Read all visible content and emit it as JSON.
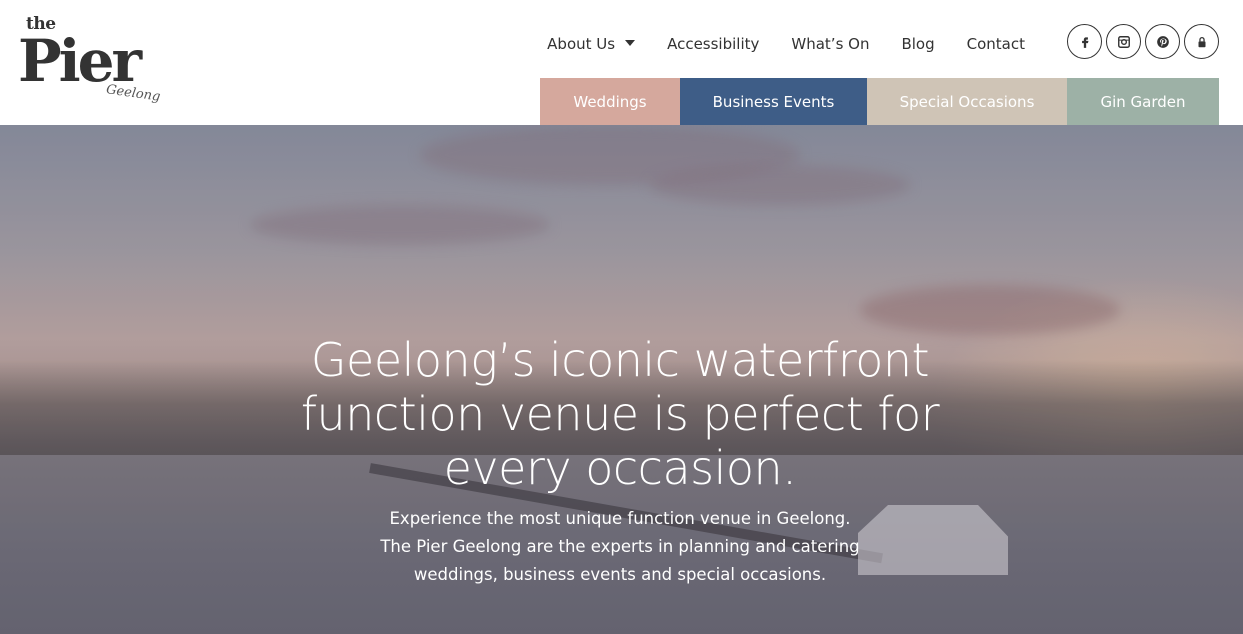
{
  "logo": {
    "the": "the",
    "pier": "Pier",
    "geelong": "Geelong"
  },
  "nav": {
    "about": "About Us",
    "accessibility": "Accessibility",
    "whats_on": "What’s On",
    "blog": "Blog",
    "contact": "Contact"
  },
  "social": [
    "facebook-icon",
    "instagram-icon",
    "pinterest-icon",
    "lock-icon"
  ],
  "tabs": {
    "weddings": "Weddings",
    "business": "Business Events",
    "special": "Special Occasions",
    "gin": "Gin Garden"
  },
  "colors": {
    "weddings": "#d5a89d",
    "business": "#3e5d87",
    "special": "#cfc4b6",
    "gin": "#9db1a6",
    "text": "#333333"
  },
  "hero": {
    "title": "Geelong’s iconic waterfront function venue is perfect for every occasion.",
    "sub_line1": "Experience the most unique function venue in Geelong.",
    "sub_line2": "The Pier Geelong are the experts in planning and catering",
    "sub_line3": "weddings, business events and special occasions."
  }
}
